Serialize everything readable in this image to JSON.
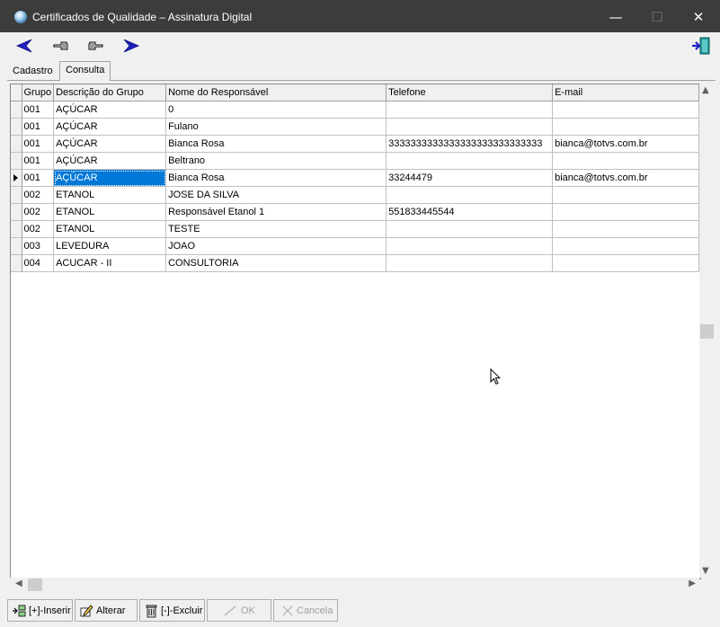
{
  "window": {
    "title": "Certificados de Qualidade – Assinatura Digital",
    "minimize": "—",
    "maximize": "☐",
    "close": "✕"
  },
  "toolbar": {
    "icons": [
      "back-arrow-icon",
      "point-left-hand-icon",
      "point-right-hand-icon",
      "forward-arrow-icon",
      "exit-door-icon"
    ]
  },
  "tabs": [
    {
      "label": "Cadastro",
      "active": false
    },
    {
      "label": "Consulta",
      "active": true
    }
  ],
  "grid": {
    "columns": [
      "Grupo",
      "Descrição do Grupo",
      "Nome do Responsável",
      "Telefone",
      "E-mail"
    ],
    "rows": [
      {
        "grupo": "001",
        "descricao": "AÇÚCAR",
        "responsavel": "0",
        "telefone": "",
        "email": ""
      },
      {
        "grupo": "001",
        "descricao": "AÇÚCAR",
        "responsavel": "Fulano",
        "telefone": "",
        "email": ""
      },
      {
        "grupo": "001",
        "descricao": "AÇÚCAR",
        "responsavel": "Bianca Rosa",
        "telefone": "3333333333333333333333333333",
        "email": "bianca@totvs.com.br"
      },
      {
        "grupo": "001",
        "descricao": "AÇÚCAR",
        "responsavel": "Beltrano",
        "telefone": "",
        "email": ""
      },
      {
        "grupo": "001",
        "descricao": "AÇÚCAR",
        "responsavel": "Bianca Rosa",
        "telefone": "33244479",
        "email": "bianca@totvs.com.br"
      },
      {
        "grupo": "002",
        "descricao": "ETANOL",
        "responsavel": "JOSE DA SILVA",
        "telefone": "",
        "email": ""
      },
      {
        "grupo": "002",
        "descricao": "ETANOL",
        "responsavel": "Responsável Etanol 1",
        "telefone": "551833445544",
        "email": ""
      },
      {
        "grupo": "002",
        "descricao": "ETANOL",
        "responsavel": "TESTE",
        "telefone": "",
        "email": ""
      },
      {
        "grupo": "003",
        "descricao": "LEVEDURA",
        "responsavel": "JOAO",
        "telefone": "",
        "email": ""
      },
      {
        "grupo": "004",
        "descricao": "ACUCAR - II",
        "responsavel": "CONSULTORIA",
        "telefone": "",
        "email": ""
      }
    ],
    "selected_row": 4,
    "selected_column": "descricao"
  },
  "buttons": {
    "inserir": "[+]-Inserir",
    "alterar": "Alterar",
    "excluir": "[-]-Excluir",
    "ok": "OK",
    "cancela": "Cancela"
  },
  "colors": {
    "titlebar": "#3c3c3c",
    "selection": "#0078d7",
    "nav_arrow": "#2020c0"
  }
}
